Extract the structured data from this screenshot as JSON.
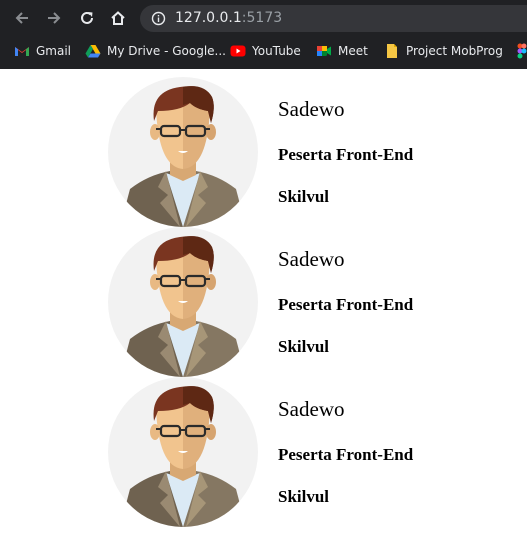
{
  "browser": {
    "url_host": "127.0.0.1",
    "url_port": ":5173",
    "bookmarks": [
      {
        "label": "Gmail",
        "icon": "gmail-icon"
      },
      {
        "label": "My Drive - Google...",
        "icon": "google-drive-icon"
      },
      {
        "label": "YouTube",
        "icon": "youtube-icon"
      },
      {
        "label": "Meet",
        "icon": "google-meet-icon"
      },
      {
        "label": "Project MobProg",
        "icon": "folder-bookmark-icon"
      }
    ]
  },
  "cards": [
    {
      "name": "Sadewo",
      "role": "Peserta Front-End",
      "org": "Skilvul"
    },
    {
      "name": "Sadewo",
      "role": "Peserta Front-End",
      "org": "Skilvul"
    },
    {
      "name": "Sadewo",
      "role": "Peserta Front-End",
      "org": "Skilvul"
    }
  ]
}
